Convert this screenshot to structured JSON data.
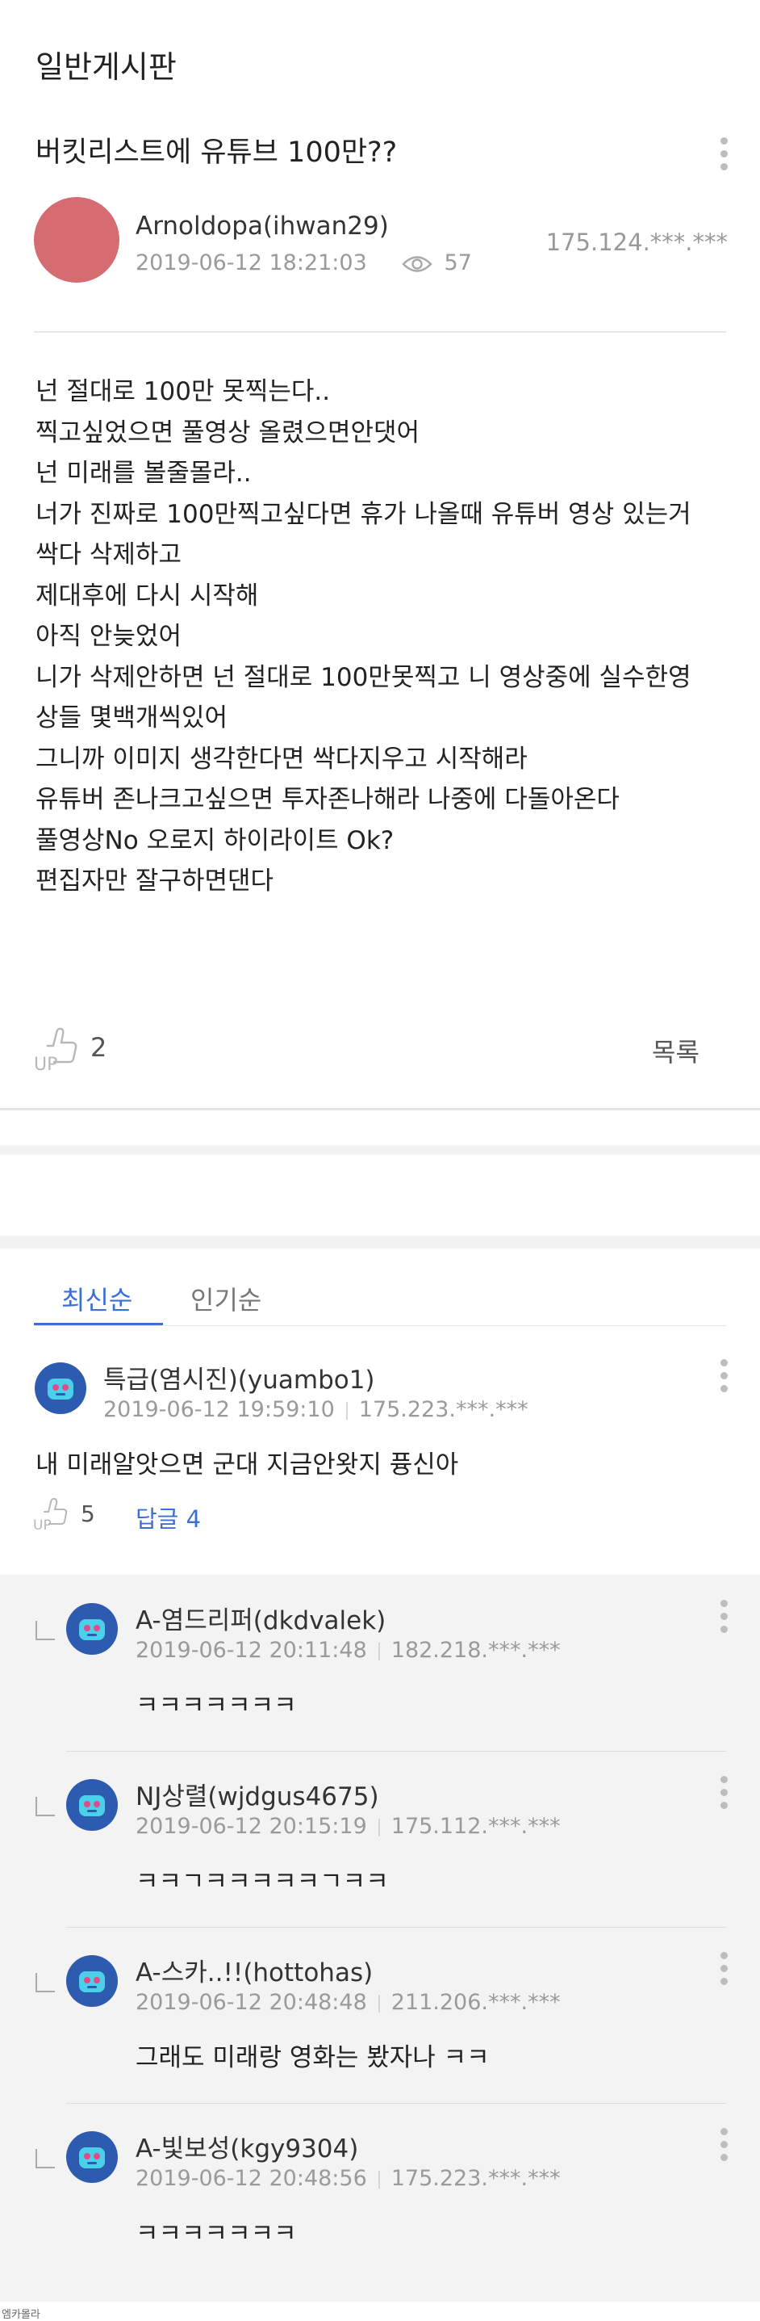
{
  "board_title": "일반게시판",
  "post": {
    "title": "버킷리스트에 유튜브 100만??",
    "author": "Arnoldopa(ihwan29)",
    "datetime": "2019-06-12 18:21:03",
    "views": "57",
    "ip": "175.124.***.***",
    "author_avatar_color": "#d46c72",
    "body_lines": [
      "넌 절대로 100만 못찍는다..",
      "찍고싶었으면 풀영상 올렸으면안댓어",
      "넌 미래를 볼줄몰라..",
      "너가 진짜로 100만찍고싶다면 휴가 나올때 유튜버 영상 있는거",
      "싹다 삭제하고",
      "제대후에 다시 시작해",
      "아직 안늦었어",
      "니가 삭제안하면 넌 절대로 100만못찍고 니 영상중에 실수한영",
      "상들 몇백개씩있어",
      "그니까 이미지 생각한다면 싹다지우고 시작해라",
      "유튜버 존나크고싶으면 투자존나해라 나중에 다돌아온다",
      "풀영상No 오로지 하이라이트 Ok?",
      "편집자만 잘구하면댄다"
    ],
    "up_count": "2",
    "list_button": "목록"
  },
  "tabs": {
    "latest": "최신순",
    "popular": "인기순",
    "active_color": "#3b6fd8"
  },
  "comment": {
    "author": "특급(염시진)(yuambo1)",
    "datetime": "2019-06-12 19:59:10",
    "ip": "175.223.***.***",
    "text": "내 미래알앗으면 군대 지금안왓지 퓽신아",
    "up_count": "5",
    "reply_label": "답글 4"
  },
  "replies": [
    {
      "author": "A-염드리퍼(dkdvalek)",
      "datetime": "2019-06-12 20:11:48",
      "ip": "182.218.***.***",
      "text": "ㅋㅋㅋㅋㅋㅋㅋ"
    },
    {
      "author": "NJ상렬(wjdgus4675)",
      "datetime": "2019-06-12 20:15:19",
      "ip": "175.112.***.***",
      "text": "ㅋㅋㄱㅋㅋㅋㅋㅋㄱㅋㅋ"
    },
    {
      "author": "A-스카..!!(hottohas)",
      "datetime": "2019-06-12 20:48:48",
      "ip": "211.206.***.***",
      "text": "그래도 미래랑 영화는 봤자나 ㅋㅋ"
    },
    {
      "author": "A-빛보성(kgy9304)",
      "datetime": "2019-06-12 20:48:56",
      "ip": "175.223.***.***",
      "text": "ㅋㅋㅋㅋㅋㅋㅋ"
    }
  ],
  "footer": "엠카몰라",
  "icons": {
    "more": "more-vertical-icon",
    "views": "eye-icon",
    "up": "thumbs-up-icon",
    "reply": "reply-arrow-icon",
    "avatar": "game-character-avatar-icon"
  }
}
